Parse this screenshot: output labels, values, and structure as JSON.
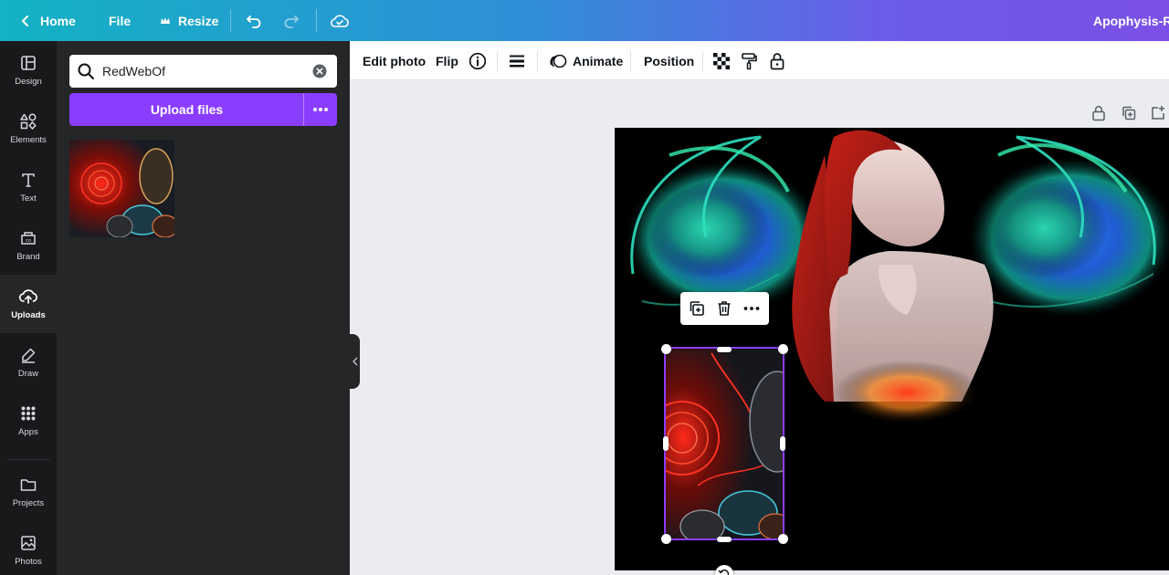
{
  "topbar": {
    "home_label": "Home",
    "file_label": "File",
    "resize_label": "Resize",
    "title": "Apophysis-Re"
  },
  "rail": {
    "items": [
      {
        "label": "Design",
        "icon": "layout-icon"
      },
      {
        "label": "Elements",
        "icon": "shapes-icon"
      },
      {
        "label": "Text",
        "icon": "text-icon"
      },
      {
        "label": "Brand",
        "icon": "brand-icon"
      },
      {
        "label": "Uploads",
        "icon": "cloud-upload-icon",
        "active": true
      },
      {
        "label": "Draw",
        "icon": "pen-icon"
      },
      {
        "label": "Apps",
        "icon": "grid-icon"
      },
      {
        "label": "Projects",
        "icon": "folder-icon"
      },
      {
        "label": "Photos",
        "icon": "image-icon"
      }
    ]
  },
  "panel": {
    "search_value": "RedWebOf",
    "upload_label": "Upload files"
  },
  "context_toolbar": {
    "edit_photo_label": "Edit photo",
    "flip_label": "Flip",
    "animate_label": "Animate",
    "position_label": "Position"
  },
  "colors": {
    "accent": "#8b3dff",
    "rail_bg": "#18191b",
    "panel_bg": "#252627"
  }
}
